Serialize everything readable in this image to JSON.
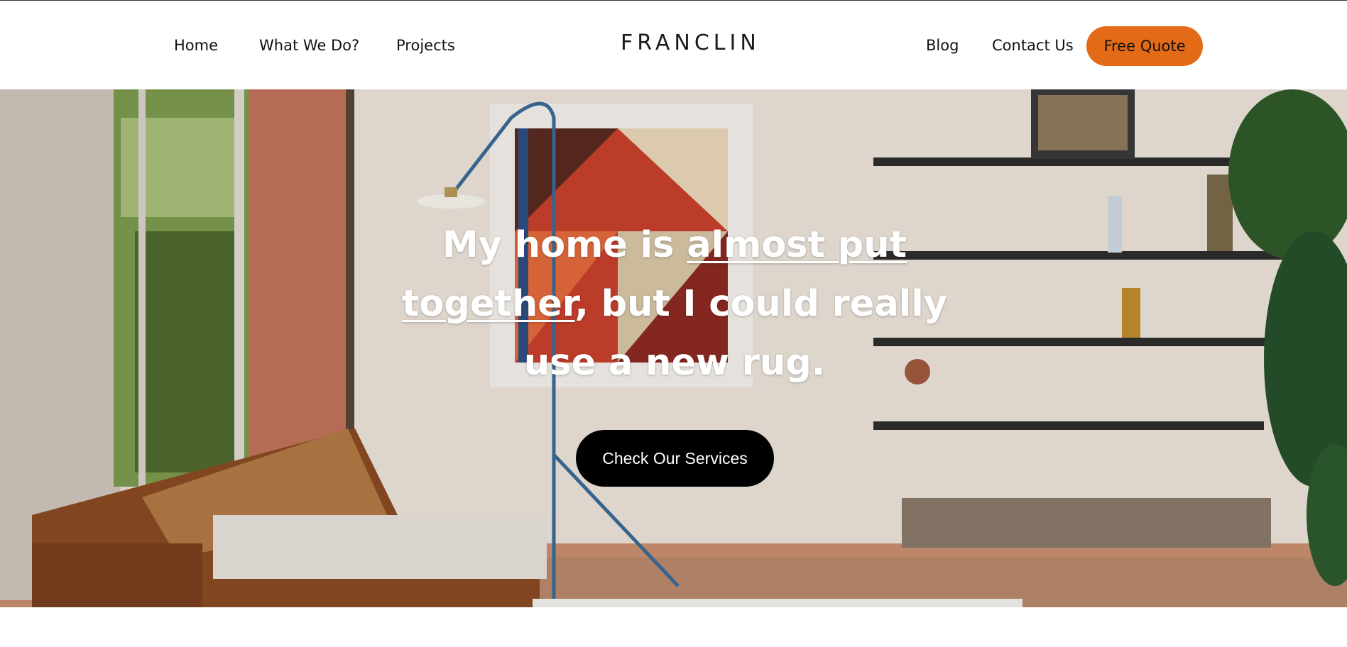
{
  "header": {
    "nav_left": [
      {
        "label": "Home"
      },
      {
        "label": "What We Do?"
      },
      {
        "label": "Projects"
      }
    ],
    "logo": "FRANCLIN",
    "nav_right": [
      {
        "label": "Blog"
      },
      {
        "label": "Contact Us"
      }
    ],
    "quote_button": "Free Quote"
  },
  "hero": {
    "headline_part1": "My home is ",
    "headline_link": "almost put together",
    "headline_part2": ", but I could really use a new rug.",
    "services_button": "Check Our Services",
    "image_description_icon": "living-room-photo"
  },
  "colors": {
    "accent": "#e36a16",
    "button_dark": "#000000",
    "text": "#111111"
  }
}
